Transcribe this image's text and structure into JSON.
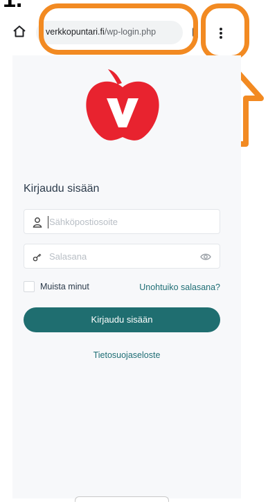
{
  "annotation": {
    "step_number": "1."
  },
  "browser": {
    "url_domain": "verkkopuntari.fi",
    "url_path": "/wp-login.php",
    "home_icon": "home-icon",
    "menu_icon": "vertical-dots-menu-icon"
  },
  "login": {
    "title": "Kirjaudu sisään",
    "email_placeholder": "Sähköpostiosoite",
    "password_placeholder": "Salasana",
    "remember_label": "Muista minut",
    "forgot_link": "Unohtuiko salasana?",
    "submit_label": "Kirjaudu sisään",
    "privacy_link": "Tietosuojaseloste"
  },
  "colors": {
    "annotation_orange": "#f28a22",
    "brand_red": "#e8232f",
    "button_teal": "#1f6e70",
    "link_teal": "#1f6e75"
  }
}
